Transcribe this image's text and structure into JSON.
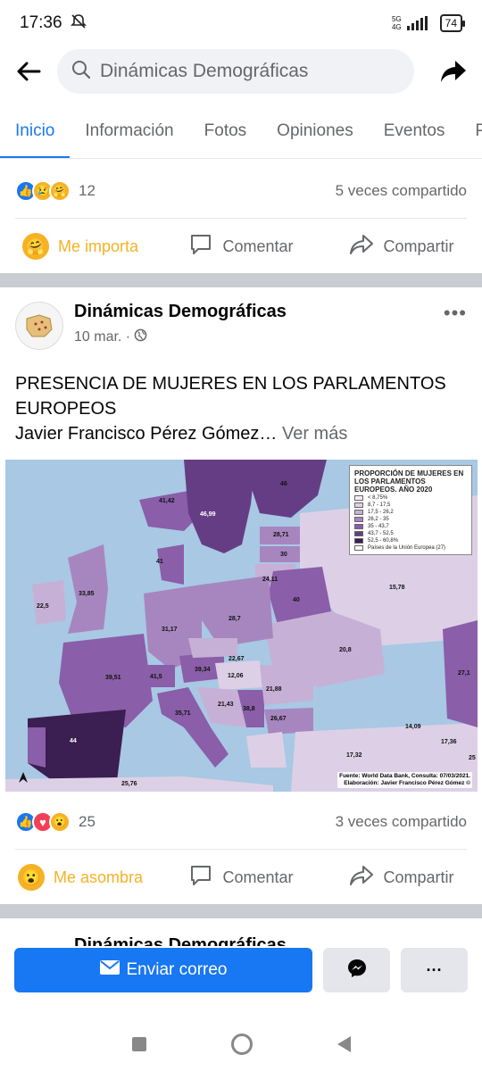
{
  "status_bar": {
    "time": "17:36",
    "network": "5G",
    "network_sub": "4G",
    "battery": "74"
  },
  "search": {
    "placeholder": "Dinámicas Demográficas"
  },
  "tabs": [
    "Inicio",
    "Información",
    "Fotos",
    "Opiniones",
    "Eventos",
    "P"
  ],
  "prev_post": {
    "reaction_count": "12",
    "shares": "5 veces compartido",
    "reaction_label": "Me importa",
    "comment_label": "Comentar",
    "share_label": "Compartir"
  },
  "post": {
    "page_name": "Dinámicas Demográficas",
    "date": "10 mar. ·",
    "text_line1": "PRESENCIA DE MUJERES EN LOS PARLAMENTOS EUROPEOS",
    "text_line2": "Javier Francisco Pérez Gómez…",
    "see_more": "Ver más",
    "reaction_count": "25",
    "shares": "3 veces compartido",
    "reaction_label": "Me asombra",
    "comment_label": "Comentar",
    "share_label": "Compartir"
  },
  "map": {
    "legend_title": "PROPORCIÓN DE MUJERES EN LOS PARLAMENTOS EUROPEOS. AÑO 2020",
    "legend": [
      {
        "label": "< 8,75%",
        "color": "#f3eef6"
      },
      {
        "label": "8,7 - 17,5",
        "color": "#ddd0e6"
      },
      {
        "label": "17,5 - 26,2",
        "color": "#c7b0d6"
      },
      {
        "label": "26,2 - 35",
        "color": "#a786bf"
      },
      {
        "label": "35 - 43,7",
        "color": "#8a5ea8"
      },
      {
        "label": "43,7 - 52,5",
        "color": "#653d85"
      },
      {
        "label": "52,5 - 60,8%",
        "color": "#3b1e52"
      },
      {
        "label": "Países de la Unión Europea (27)",
        "color": "#ffffff"
      }
    ],
    "values": {
      "iceland": "41,42",
      "sweden": "46,99",
      "finland": "46",
      "estonia": "28,71",
      "latvia": "30",
      "lithuania": "24,11",
      "norway_dk": "41",
      "uk": "33,85",
      "ireland": "22,5",
      "belarus": "40",
      "russia": "15,78",
      "germany": "31,17",
      "poland": "28,7",
      "ukraine": "20,8",
      "czech": "22,67",
      "austria": "39,34",
      "hungary": "12,06",
      "france": "39,51",
      "switzerland": "41,5",
      "italy": "35,71",
      "croatia": "21,43",
      "serbia": "38,8",
      "romania": "21,88",
      "bulgaria": "26,67",
      "turkey": "17,32",
      "georgia": "14,09",
      "spain": "44",
      "kazakh": "27,1",
      "armenia": "17,36",
      "algeria": "25,76",
      "east_edge": "25"
    },
    "source_line1": "Fuente: World Data Bank, Consulta: 07/03/2021.",
    "source_line2": "Elaboración: Javier Francisco Pérez Gómez ©"
  },
  "next_post": {
    "page_name": "Dinámicas Demográficas"
  },
  "bottom_bar": {
    "email_label": "Enviar correo",
    "more_label": "···"
  },
  "colors": {
    "brand_blue": "#1877f2",
    "grey_text": "#65676b",
    "reaction_yellow": "#f7b125"
  }
}
